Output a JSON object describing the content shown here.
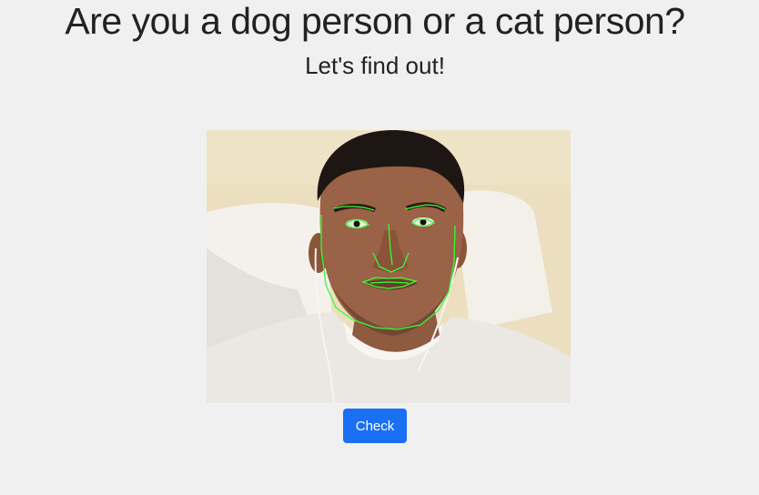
{
  "header": {
    "title": "Are you a dog person or a cat person?",
    "subtitle": "Let's find out!"
  },
  "photo": {
    "subject": "webcam-face-photo",
    "landmark_color": "#33ff33"
  },
  "actions": {
    "check_label": "Check",
    "check_color": "#1a6ff2"
  },
  "colors": {
    "background": "#f0f0f0",
    "text": "#222222"
  }
}
